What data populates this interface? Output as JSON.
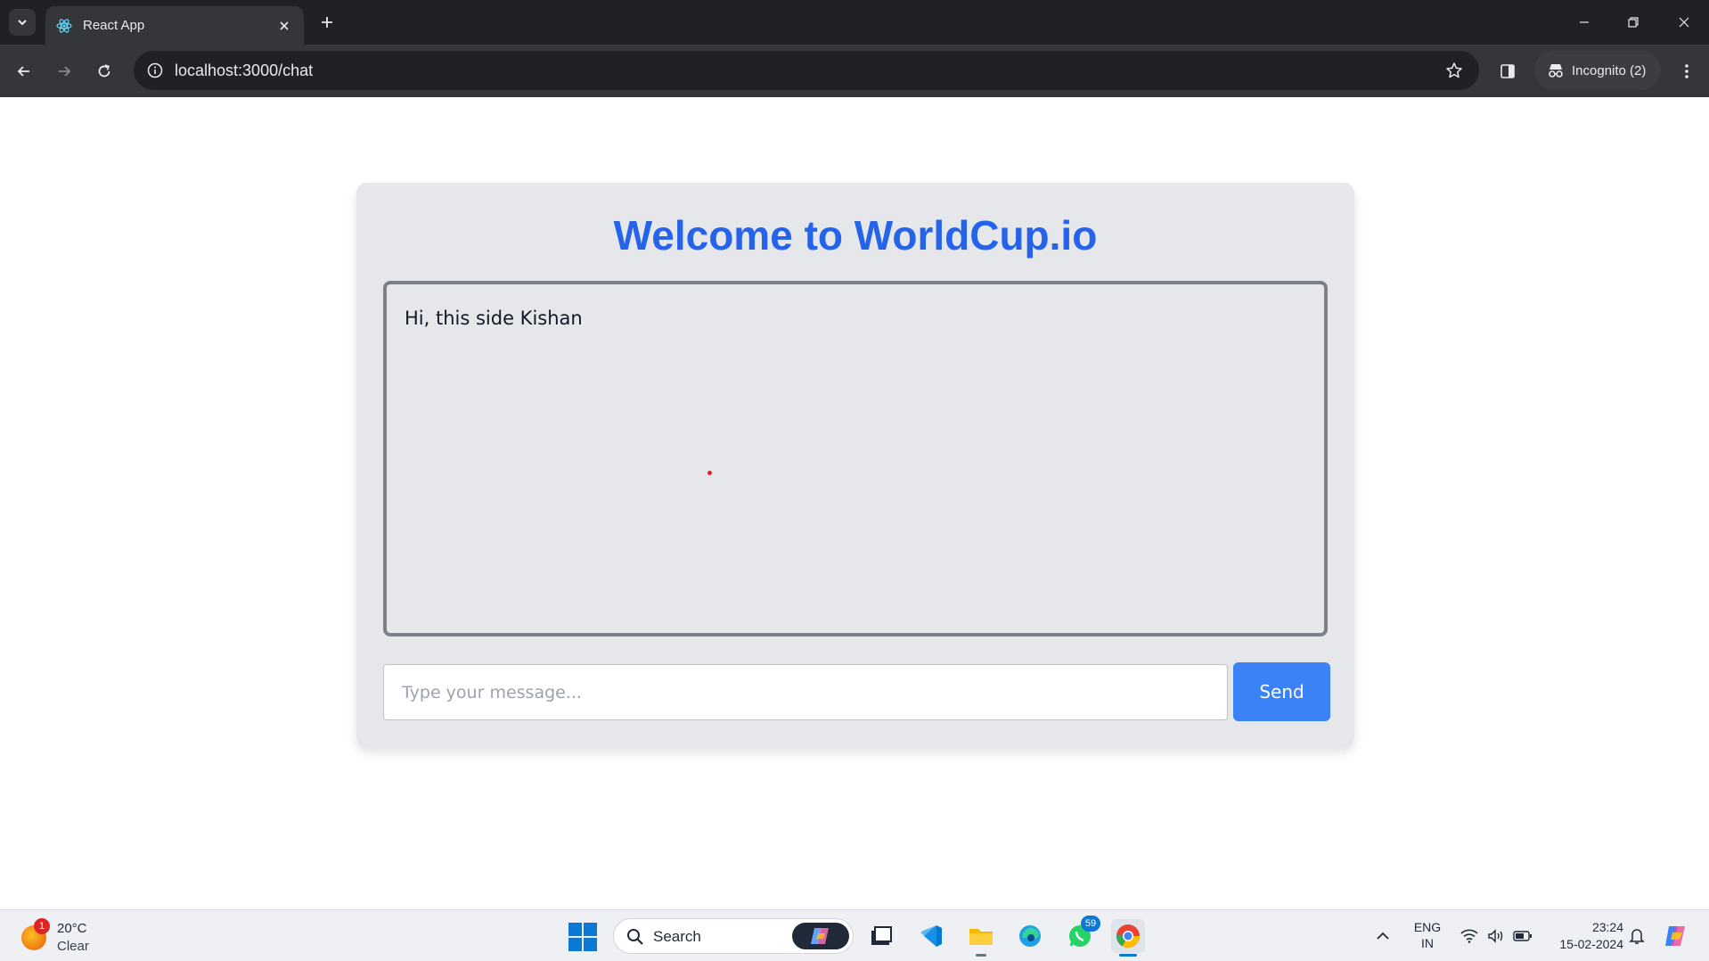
{
  "browser": {
    "tab_title": "React App",
    "url": "localhost:3000/chat",
    "profile_label": "Incognito (2)"
  },
  "app": {
    "title": "Welcome to WorldCup.io",
    "messages": [
      {
        "text": "Hi, this side Kishan"
      }
    ],
    "input": {
      "value": "",
      "placeholder": "Type your message..."
    },
    "send_label": "Send",
    "colors": {
      "accent": "#2563eb",
      "button": "#3b82f6",
      "card": "#e5e7eb"
    }
  },
  "taskbar": {
    "weather": {
      "temp": "20°C",
      "condition": "Clear",
      "badge": "1"
    },
    "search_label": "Search",
    "whatsapp_badge": "59",
    "language": {
      "line1": "ENG",
      "line2": "IN"
    },
    "clock": {
      "time": "23:24",
      "date": "15-02-2024"
    },
    "apps": [
      "copilot-icon",
      "file-explorer-icon",
      "vscode-icon",
      "folder-icon",
      "edge-icon",
      "whatsapp-icon",
      "chrome-icon"
    ]
  }
}
